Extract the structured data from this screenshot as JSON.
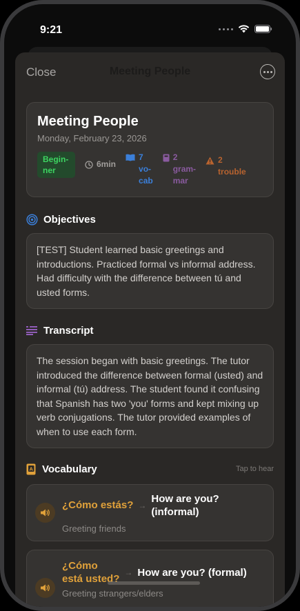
{
  "status_bar": {
    "time": "9:21"
  },
  "nav": {
    "close_label": "Close",
    "title": "Meeting People"
  },
  "summary": {
    "title": "Meeting People",
    "date": "Monday, February 23, 2026",
    "level_line1": "Begin-",
    "level_line2": "ner",
    "duration": "6min",
    "vocab_line1": "7",
    "vocab_line2": "vo-",
    "vocab_line3": "cab",
    "grammar_line1": "2",
    "grammar_line2": "gram-",
    "grammar_line3": "mar",
    "trouble_line1": "2",
    "trouble_line2": "trouble"
  },
  "objectives": {
    "title": "Objectives",
    "text": "[TEST] Student learned basic greetings and introductions. Practiced formal vs informal address. Had difficulty with the difference between tú and usted forms."
  },
  "transcript": {
    "title": "Transcript",
    "text": "The session began with basic greetings. The tutor introduced the difference between formal (usted) and informal (tú) address. The student found it confusing that Spanish has two 'you' forms and kept mixing up verb conjugations. The tutor provided examples of when to use each form."
  },
  "vocabulary": {
    "title": "Vocabulary",
    "hint": "Tap to hear",
    "items": [
      {
        "term": "¿Cómo estás?",
        "translation_line1": "How are you?",
        "translation_line2": "(informal)",
        "note": "Greeting friends"
      },
      {
        "term_line1": "¿Cómo",
        "term_line2": "está usted?",
        "translation": "How are you? (formal)",
        "note": "Greeting strangers/elders"
      }
    ]
  },
  "colors": {
    "accent_orange": "#e0a13a",
    "vocab_blue": "#3b7fd9",
    "grammar_purple": "#8a5b9f",
    "trouble_orange": "#b8632f",
    "beginner_green": "#3dd461"
  }
}
